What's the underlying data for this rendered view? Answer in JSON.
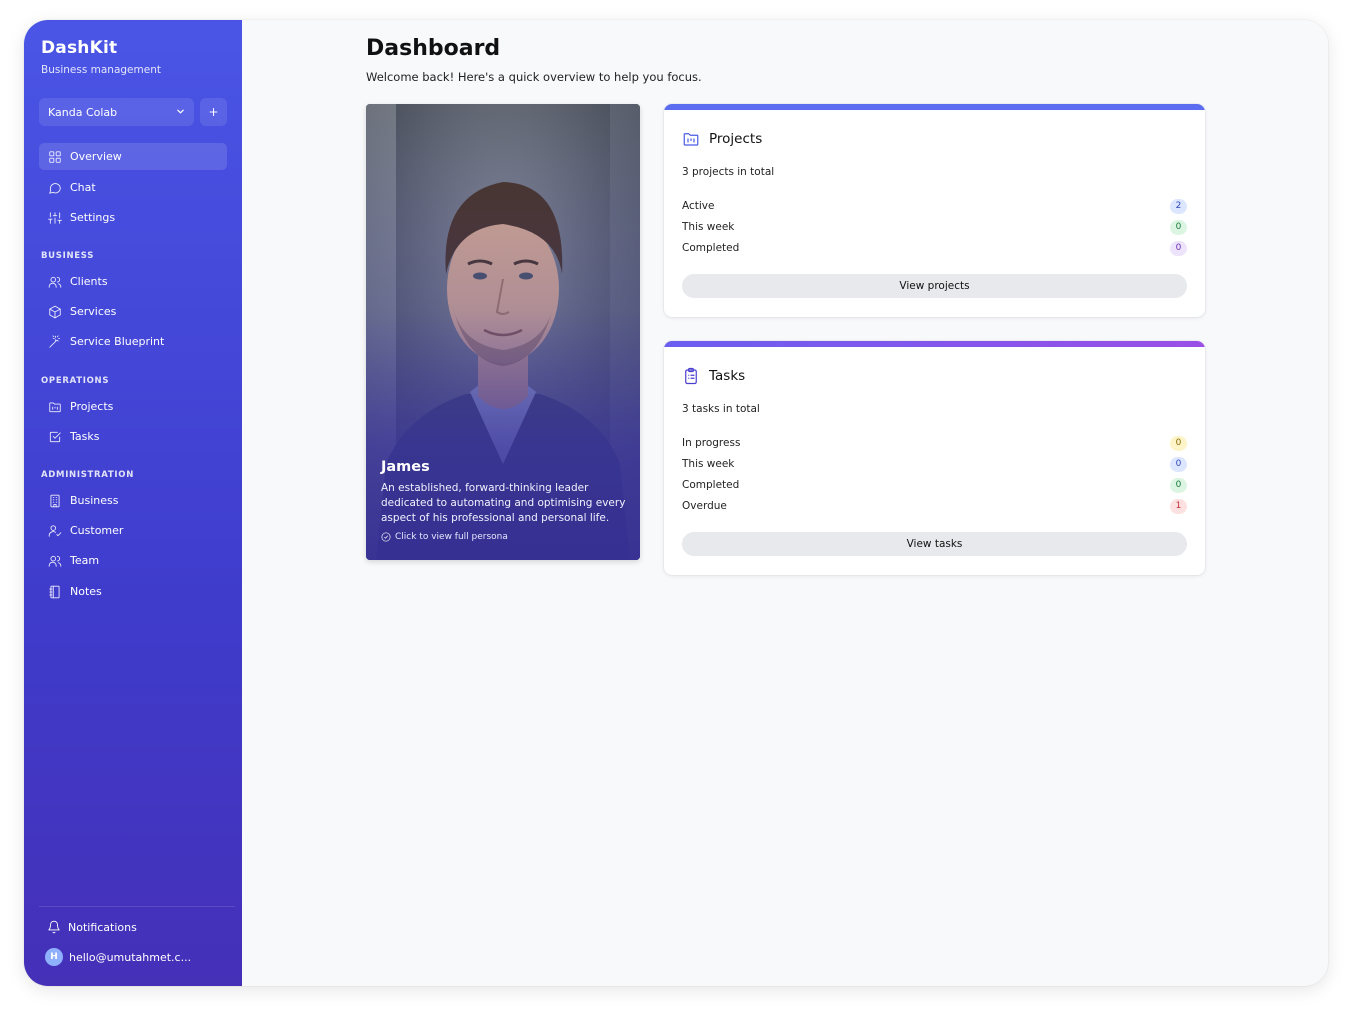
{
  "sidebar": {
    "brand_title": "DashKit",
    "brand_subtitle": "Business management",
    "workspace": "Kanda Colab",
    "add_label": "+",
    "main_items": [
      {
        "label": "Overview",
        "icon": "grid-icon",
        "active": true
      },
      {
        "label": "Chat",
        "icon": "chat-icon"
      },
      {
        "label": "Settings",
        "icon": "sliders-icon"
      }
    ],
    "sections": [
      {
        "label": "BUSINESS",
        "items": [
          {
            "label": "Clients",
            "icon": "users-icon"
          },
          {
            "label": "Services",
            "icon": "box-icon"
          },
          {
            "label": "Service Blueprint",
            "icon": "wand-icon"
          }
        ]
      },
      {
        "label": "OPERATIONS",
        "items": [
          {
            "label": "Projects",
            "icon": "folder-icon"
          },
          {
            "label": "Tasks",
            "icon": "check-square-icon"
          }
        ]
      },
      {
        "label": "ADMINISTRATION",
        "items": [
          {
            "label": "Business",
            "icon": "building-icon"
          },
          {
            "label": "Customer",
            "icon": "user-check-icon"
          },
          {
            "label": "Team",
            "icon": "team-icon"
          },
          {
            "label": "Notes",
            "icon": "notebook-icon"
          }
        ]
      }
    ],
    "notifications_label": "Notifications",
    "user_initial": "H",
    "user_email": "hello@umutahmet.c..."
  },
  "header": {
    "title": "Dashboard",
    "subtitle": "Welcome back! Here's a quick overview to help you focus."
  },
  "persona": {
    "name": "James",
    "description": "An established, forward-thinking leader dedicated to automating and optimising every aspect of his professional and personal life.",
    "link": "Click to view full persona"
  },
  "projects": {
    "title": "Projects",
    "total": "3 projects in total",
    "rows": [
      {
        "label": "Active",
        "value": "2",
        "bg": "#dde6ff",
        "fg": "#3048b8"
      },
      {
        "label": "This week",
        "value": "0",
        "bg": "#dcf5e3",
        "fg": "#177a3a"
      },
      {
        "label": "Completed",
        "value": "0",
        "bg": "#ede3fb",
        "fg": "#6b35b5"
      }
    ],
    "button": "View projects",
    "accent": "#5b6cf0"
  },
  "tasks": {
    "title": "Tasks",
    "total": "3 tasks in total",
    "rows": [
      {
        "label": "In progress",
        "value": "0",
        "bg": "#fdf4c9",
        "fg": "#8a6b00"
      },
      {
        "label": "This week",
        "value": "0",
        "bg": "#dde6ff",
        "fg": "#3048b8"
      },
      {
        "label": "Completed",
        "value": "0",
        "bg": "#dcf5e3",
        "fg": "#177a3a"
      },
      {
        "label": "Overdue",
        "value": "1",
        "bg": "#fde0e0",
        "fg": "#c0303a"
      }
    ],
    "button": "View tasks",
    "accent": "#8b4fe6"
  }
}
